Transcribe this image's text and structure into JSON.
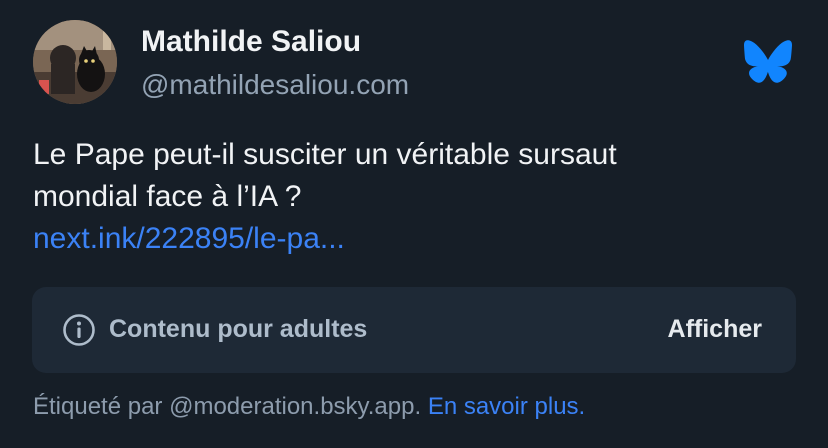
{
  "author": {
    "display_name": "Mathilde Saliou",
    "handle": "@mathildesaliou.com"
  },
  "post": {
    "text_line1": "Le Pape peut-il susciter un véritable sursaut",
    "text_line2": "mondial face à l’IA ?",
    "link_text": "next.ink/222895/le-pa..."
  },
  "content_warning": {
    "label": "Contenu pour adultes",
    "show_label": "Afficher",
    "icon": "info-circle-icon"
  },
  "footer": {
    "labeled_by": "Étiqueté par @moderation.bsky.app.",
    "learn_more": "En savoir plus."
  },
  "colors": {
    "background": "#161e27",
    "card_bg": "#1e2936",
    "accent_blue": "#3b82f6",
    "butterfly": "#1185fe"
  }
}
